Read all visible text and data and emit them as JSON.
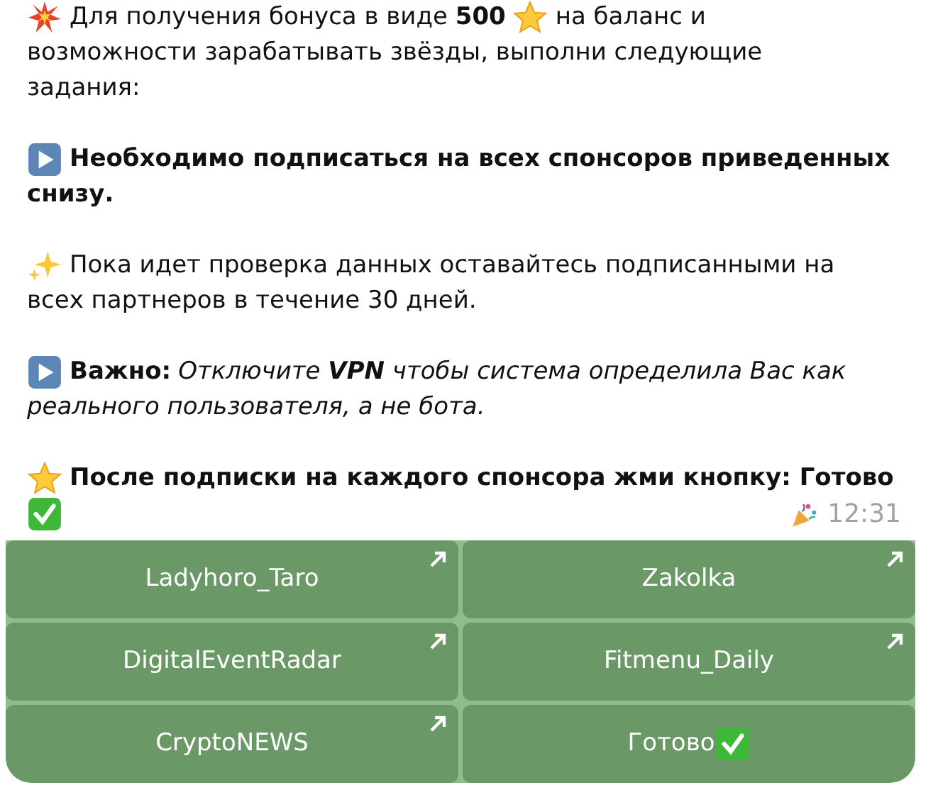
{
  "message": {
    "paragraphs": [
      {
        "bold": false,
        "lines": [
          [
            {
              "kind": "burst"
            },
            {
              "kind": "text",
              "text": "Для получения бонуса в виде **500**"
            },
            {
              "kind": "star"
            },
            {
              "kind": "text",
              "text": "на баланс и"
            }
          ],
          [
            {
              "kind": "text",
              "text": "возможности зарабатывать звёзды, выполни следующие"
            }
          ],
          [
            {
              "kind": "text",
              "text": "задания:"
            }
          ]
        ]
      },
      {
        "bold": true,
        "lines": [
          [
            {
              "kind": "play"
            },
            {
              "kind": "text",
              "text": "Необходимо подписаться на всех спонсоров приведенных"
            }
          ],
          [
            {
              "kind": "text",
              "text": "снизу."
            }
          ]
        ]
      },
      {
        "bold": false,
        "lines": [
          [
            {
              "kind": "sparkles"
            },
            {
              "kind": "text",
              "text": "Пока идет проверка данных оставайтесь подписанными на"
            }
          ],
          [
            {
              "kind": "text",
              "text": "всех партнеров в течение 30 дней."
            }
          ]
        ]
      },
      {
        "bold": false,
        "lines": [
          [
            {
              "kind": "play"
            },
            {
              "kind": "text",
              "text": "**Важно:**"
            },
            {
              "kind": "text",
              "italic": true,
              "text": "Отключите **VPN** чтобы система определила Вас как"
            }
          ],
          [
            {
              "kind": "text",
              "italic": true,
              "text": "реального пользователя, а не бота."
            }
          ]
        ]
      },
      {
        "bold": true,
        "lines": [
          [
            {
              "kind": "star"
            },
            {
              "kind": "text",
              "text": "После подписки на каждого спонсора жми кнопку: Готово"
            }
          ],
          [
            {
              "kind": "check"
            }
          ]
        ]
      }
    ],
    "time": "12:31"
  },
  "buttons": [
    {
      "label": "Ladyhoro_Taro",
      "kind": "link"
    },
    {
      "label": "Zakolka",
      "kind": "link"
    },
    {
      "label": "DigitalEventRadar",
      "kind": "link"
    },
    {
      "label": "Fitmenu_Daily",
      "kind": "link"
    },
    {
      "label": "CryptoNEWS",
      "kind": "link"
    },
    {
      "label": "Готово",
      "kind": "check"
    }
  ]
}
